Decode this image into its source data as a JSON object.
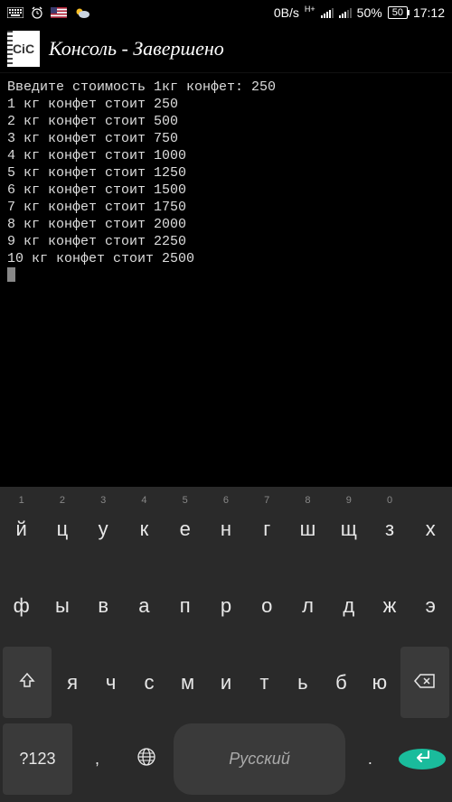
{
  "status": {
    "speed": "0B/s",
    "signal_type": "H+",
    "battery_pct": "50%",
    "battery_box": "50",
    "time": "17:12"
  },
  "app": {
    "icon_text": "CiC",
    "title": "Консоль - Завершено"
  },
  "console": {
    "prompt": "Введите стоимость 1кг конфет: 250",
    "lines": [
      "1 кг конфет стоит 250",
      "2 кг конфет стоит 500",
      "3 кг конфет стоит 750",
      "4 кг конфет стоит 1000",
      "5 кг конфет стоит 1250",
      "6 кг конфет стоит 1500",
      "7 кг конфет стоит 1750",
      "8 кг конфет стоит 2000",
      "9 кг конфет стоит 2250",
      "10 кг конфет стоит 2500"
    ]
  },
  "keyboard": {
    "row1_nums": [
      "1",
      "2",
      "3",
      "4",
      "5",
      "6",
      "7",
      "8",
      "9",
      "0"
    ],
    "row1": [
      "й",
      "ц",
      "у",
      "к",
      "е",
      "н",
      "г",
      "ш",
      "щ",
      "з",
      "х"
    ],
    "row2": [
      "ф",
      "ы",
      "в",
      "а",
      "п",
      "р",
      "о",
      "л",
      "д",
      "ж",
      "э"
    ],
    "row3": [
      "я",
      "ч",
      "с",
      "м",
      "и",
      "т",
      "ь",
      "б",
      "ю"
    ],
    "sym": "?123",
    "comma": ",",
    "period": ".",
    "space_label": "Русский"
  }
}
